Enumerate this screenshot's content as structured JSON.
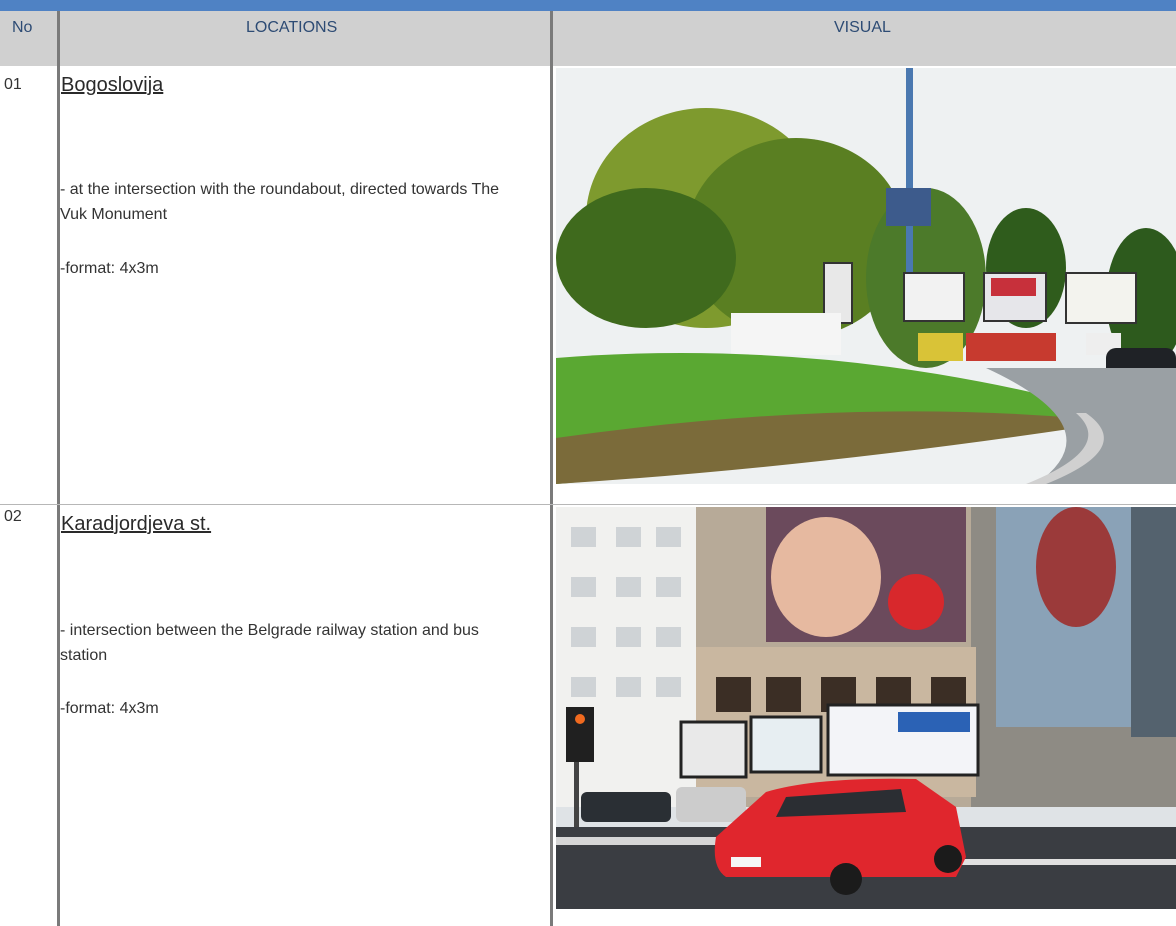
{
  "header": {
    "no": "No",
    "locations": "LOCATIONS",
    "visual": "VISUAL"
  },
  "rows": [
    {
      "number": "01",
      "location": "Bogoslovija",
      "description": " - at the intersection with the roundabout, directed towards The Vuk Monument",
      "format": "-format: 4x3m",
      "photo_alt": "roundabout with billboards and trees"
    },
    {
      "number": "02",
      "location": "Karadjordjeva st.",
      "description": "-   intersection between the Belgrade railway station and bus station",
      "format": "-format: 4x3m",
      "photo_alt": "building with large billboards and red car"
    }
  ]
}
